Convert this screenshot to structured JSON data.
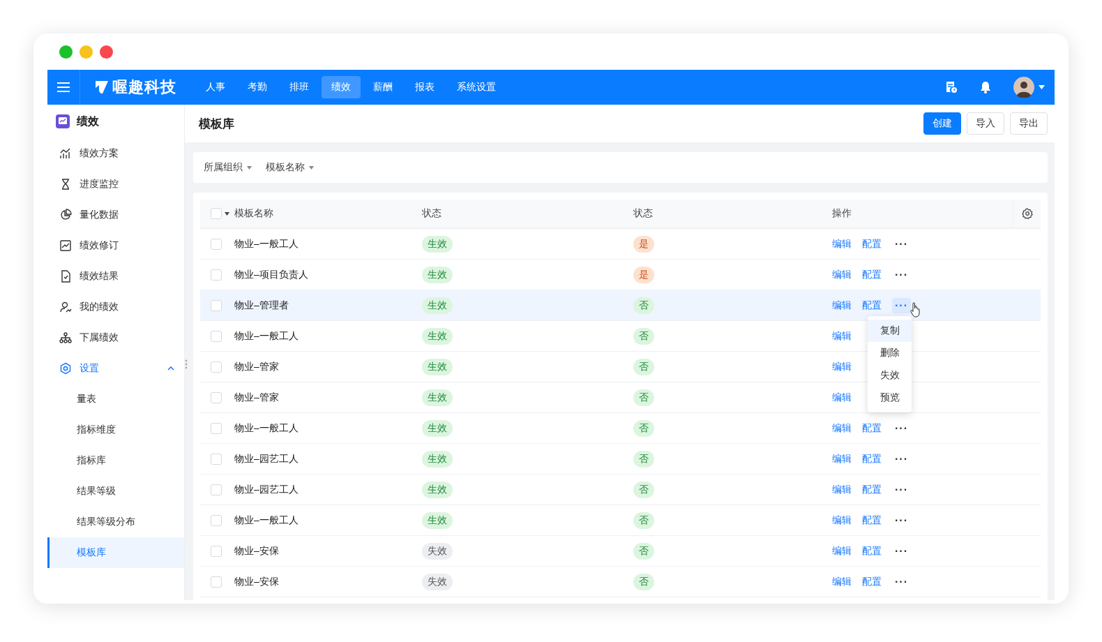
{
  "brand": "喔趣科技",
  "nav": [
    {
      "label": "人事",
      "selected": false
    },
    {
      "label": "考勤",
      "selected": false
    },
    {
      "label": "排班",
      "selected": false
    },
    {
      "label": "绩效",
      "selected": true
    },
    {
      "label": "薪酬",
      "selected": false
    },
    {
      "label": "报表",
      "selected": false
    },
    {
      "label": "系统设置",
      "selected": false
    }
  ],
  "sidebar": {
    "title": "绩效",
    "items": [
      {
        "label": "绩效方案",
        "selected": false
      },
      {
        "label": "进度监控",
        "selected": false
      },
      {
        "label": "量化数据",
        "selected": false
      },
      {
        "label": "绩效修订",
        "selected": false
      },
      {
        "label": "绩效结果",
        "selected": false
      },
      {
        "label": "我的绩效",
        "selected": false
      },
      {
        "label": "下属绩效",
        "selected": false
      },
      {
        "label": "设置",
        "selected": false,
        "expanded": true,
        "children": [
          {
            "label": "量表",
            "selected": false
          },
          {
            "label": "指标维度",
            "selected": false
          },
          {
            "label": "指标库",
            "selected": false
          },
          {
            "label": "结果等级",
            "selected": false
          },
          {
            "label": "结果等级分布",
            "selected": false
          },
          {
            "label": "模板库",
            "selected": true
          }
        ]
      }
    ]
  },
  "page": {
    "title": "模板库",
    "buttons": [
      {
        "label": "创建",
        "kind": "primary"
      },
      {
        "label": "导入",
        "kind": "default"
      },
      {
        "label": "导出",
        "kind": "default"
      }
    ]
  },
  "filters": [
    "所属组织",
    "模板名称"
  ],
  "table": {
    "all_checked": false,
    "columns": [
      "模板名称",
      "状态",
      "状态",
      "操作"
    ],
    "rows": [
      {
        "name": "物业–一般工人",
        "status": {
          "label": "生效",
          "kind": "active"
        },
        "flag": {
          "label": "是",
          "kind": "yes"
        },
        "actions": [
          "编辑",
          "配置"
        ],
        "more": "···",
        "selected": false,
        "checked": false
      },
      {
        "name": "物业–项目负责人",
        "status": {
          "label": "生效",
          "kind": "active"
        },
        "flag": {
          "label": "是",
          "kind": "yes"
        },
        "actions": [
          "编辑",
          "配置"
        ],
        "more": "···",
        "selected": false,
        "checked": false
      },
      {
        "name": "物业–管理者",
        "status": {
          "label": "生效",
          "kind": "active"
        },
        "flag": {
          "label": "否",
          "kind": "no"
        },
        "actions": [
          "编辑",
          "配置"
        ],
        "more": "···",
        "selected": true,
        "checked": false,
        "menu": [
          {
            "label": "复制",
            "selected": true
          },
          {
            "label": "删除",
            "selected": false
          },
          {
            "label": "失效",
            "selected": false
          },
          {
            "label": "预览",
            "selected": false
          }
        ]
      },
      {
        "name": "物业–一般工人",
        "status": {
          "label": "生效",
          "kind": "active"
        },
        "flag": {
          "label": "否",
          "kind": "no"
        },
        "actions": [
          "编辑"
        ],
        "selected": false,
        "checked": false
      },
      {
        "name": "物业–管家",
        "status": {
          "label": "生效",
          "kind": "active"
        },
        "flag": {
          "label": "否",
          "kind": "no"
        },
        "actions": [
          "编辑"
        ],
        "selected": false,
        "checked": false
      },
      {
        "name": "物业–管家",
        "status": {
          "label": "生效",
          "kind": "active"
        },
        "flag": {
          "label": "否",
          "kind": "no"
        },
        "actions": [
          "编辑"
        ],
        "selected": false,
        "checked": false
      },
      {
        "name": "物业–一般工人",
        "status": {
          "label": "生效",
          "kind": "active"
        },
        "flag": {
          "label": "否",
          "kind": "no"
        },
        "actions": [
          "编辑",
          "配置"
        ],
        "more": "···",
        "selected": false,
        "checked": false
      },
      {
        "name": "物业–园艺工人",
        "status": {
          "label": "生效",
          "kind": "active"
        },
        "flag": {
          "label": "否",
          "kind": "no"
        },
        "actions": [
          "编辑",
          "配置"
        ],
        "more": "···",
        "selected": false,
        "checked": false
      },
      {
        "name": "物业–园艺工人",
        "status": {
          "label": "生效",
          "kind": "active"
        },
        "flag": {
          "label": "否",
          "kind": "no"
        },
        "actions": [
          "编辑",
          "配置"
        ],
        "more": "···",
        "selected": false,
        "checked": false
      },
      {
        "name": "物业–一般工人",
        "status": {
          "label": "生效",
          "kind": "active"
        },
        "flag": {
          "label": "否",
          "kind": "no"
        },
        "actions": [
          "编辑",
          "配置"
        ],
        "more": "···",
        "selected": false,
        "checked": false
      },
      {
        "name": "物业–安保",
        "status": {
          "label": "失效",
          "kind": "inactive"
        },
        "flag": {
          "label": "否",
          "kind": "no"
        },
        "actions": [
          "编辑",
          "配置"
        ],
        "more": "···",
        "selected": false,
        "checked": false
      },
      {
        "name": "物业–安保",
        "status": {
          "label": "失效",
          "kind": "inactive"
        },
        "flag": {
          "label": "否",
          "kind": "no"
        },
        "actions": [
          "编辑",
          "配置"
        ],
        "more": "···",
        "selected": false,
        "checked": false
      }
    ]
  }
}
